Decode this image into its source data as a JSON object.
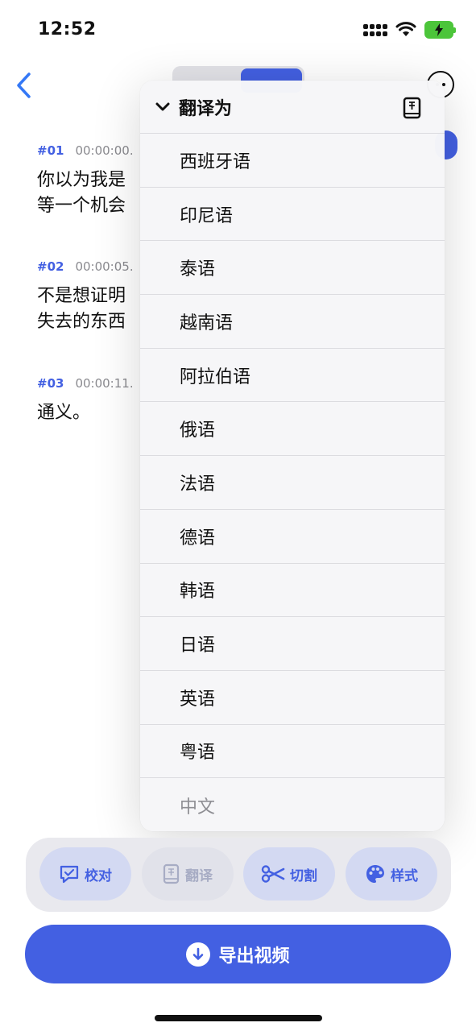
{
  "status": {
    "time": "12:52"
  },
  "subtitles": [
    {
      "index": "#01",
      "timecode": "00:00:00.",
      "lines": [
        "你以为我是",
        "等一个机会"
      ]
    },
    {
      "index": "#02",
      "timecode": "00:00:05.",
      "lines": [
        "不是想证明",
        "失去的东西"
      ]
    },
    {
      "index": "#03",
      "timecode": "00:00:11.",
      "lines": [
        "通义。"
      ]
    }
  ],
  "menu": {
    "title": "翻译为",
    "items": [
      "西班牙语",
      "印尼语",
      "泰语",
      "越南语",
      "阿拉伯语",
      "俄语",
      "法语",
      "德语",
      "韩语",
      "日语",
      "英语",
      "粤语",
      "中文"
    ]
  },
  "toolbar": {
    "proofread": "校对",
    "translate": "翻译",
    "cut": "切割",
    "style": "样式"
  },
  "export_label": "导出视频",
  "colors": {
    "accent": "#4360e2",
    "battery": "#4cc53a"
  },
  "icons": [
    "back-chevron-icon",
    "more-icon",
    "chevron-down-icon",
    "dictionary-icon",
    "proofread-icon",
    "translate-icon",
    "scissors-icon",
    "palette-icon",
    "download-icon"
  ]
}
